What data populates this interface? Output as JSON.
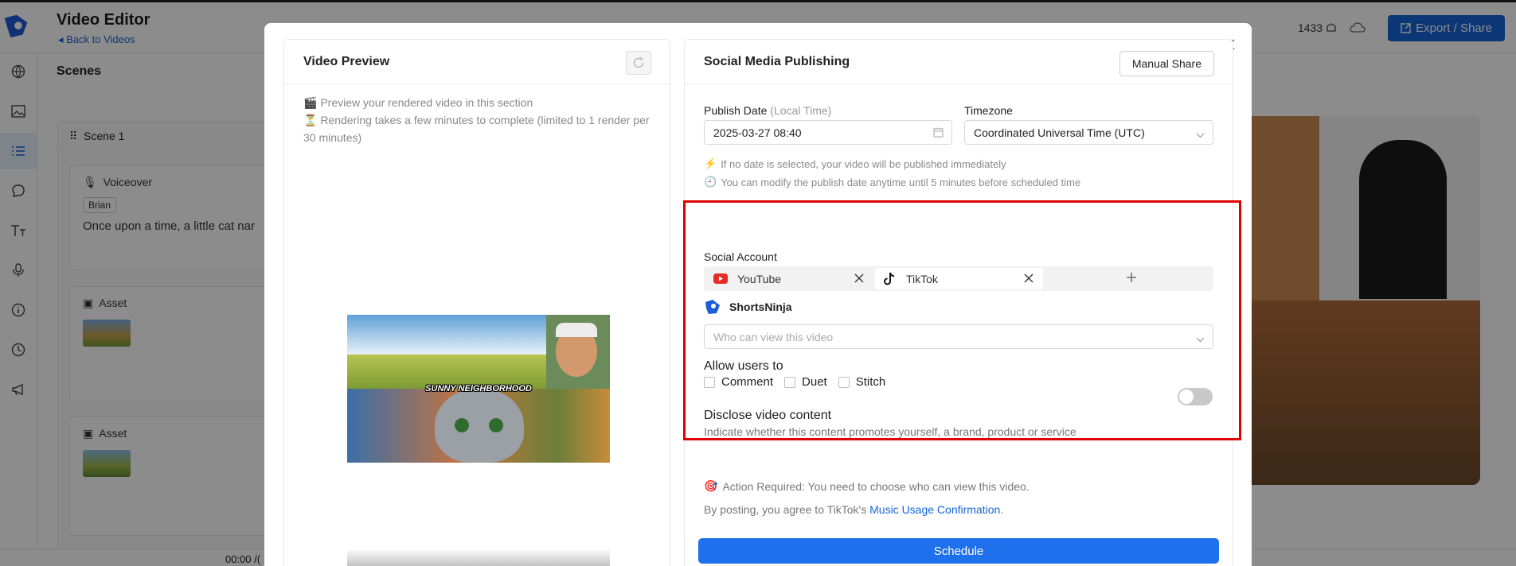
{
  "app": {
    "title": "Video Editor",
    "back_label": "Back to Videos",
    "credits": "1433",
    "export_label": "Export / Share",
    "accent": "#1565d8"
  },
  "sidebar": {
    "items": [
      {
        "icon": "globe-icon"
      },
      {
        "icon": "image-icon"
      },
      {
        "icon": "list-icon",
        "active": true
      },
      {
        "icon": "chat-icon"
      },
      {
        "icon": "text-icon"
      },
      {
        "icon": "microphone-icon"
      },
      {
        "icon": "info-icon"
      },
      {
        "icon": "clock-icon"
      },
      {
        "icon": "megaphone-icon"
      }
    ]
  },
  "scenes": {
    "title": "Scenes",
    "scene_label": "Scene 1",
    "voiceover_label": "Voiceover",
    "voice_name": "Brian",
    "voiceover_text": "Once upon a time, a little cat nar",
    "asset_label": "Asset"
  },
  "timeline": {
    "time": "00:00 /("
  },
  "modal": {
    "preview": {
      "title": "Video Preview",
      "note1": "🎬 Preview your rendered video in this section",
      "note2": "⏳ Rendering takes a few minutes to complete (limited to 1 render per 30 minutes)",
      "video_caption": "SUNNY NEIGHBORHOOD"
    },
    "publishing": {
      "title": "Social Media Publishing",
      "manual_share_label": "Manual Share",
      "publish_date_label": "Publish Date",
      "publish_date_suffix": "(Local Time)",
      "publish_date_value": "2025-03-27 08:40",
      "timezone_label": "Timezone",
      "timezone_value": "Coordinated Universal Time (UTC)",
      "hint_immediate": "If no date is selected, your video will be published immediately",
      "hint_modify": "You can modify the publish date anytime until 5 minutes before scheduled time",
      "social_account_label": "Social Account",
      "accounts": [
        {
          "name": "YouTube",
          "icon": "youtube-icon",
          "color": "#e52d27"
        },
        {
          "name": "TikTok",
          "icon": "tiktok-icon",
          "color": "#111111"
        }
      ],
      "channel_name": "ShortsNinja",
      "who_can_view_placeholder": "Who can view this video",
      "allow_users_label": "Allow users to",
      "allow_options": [
        "Comment",
        "Duet",
        "Stitch"
      ],
      "disclose_title": "Disclose video content",
      "disclose_desc": "Indicate whether this content promotes yourself, a brand, product or service",
      "disclose_enabled": false,
      "action_required": "Action Required: You need to choose who can view this video.",
      "agree_prefix": "By posting, you agree to TikTok's ",
      "agree_link": "Music Usage Confirmation",
      "agree_suffix": ".",
      "schedule_label": "Schedule",
      "highlight_color": "#e00000"
    }
  }
}
